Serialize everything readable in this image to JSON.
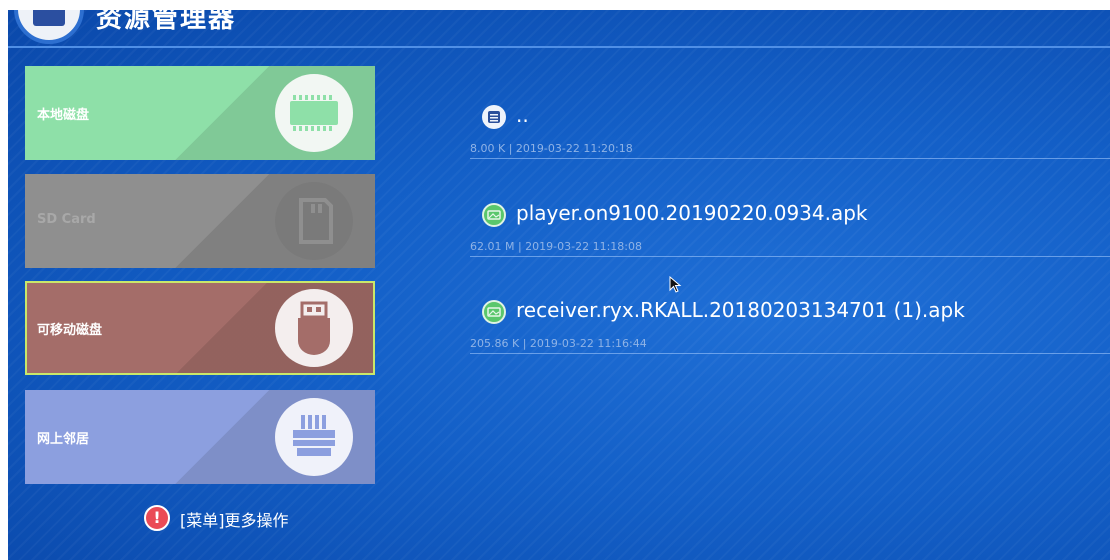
{
  "header": {
    "title": "资源管理器"
  },
  "sidebar": {
    "items": [
      {
        "label": "本地磁盘",
        "icon": "memory-chip-icon"
      },
      {
        "label": "SD Card",
        "icon": "sd-card-icon"
      },
      {
        "label": "可移动磁盘",
        "icon": "usb-drive-icon"
      },
      {
        "label": "网上邻居",
        "icon": "network-adapter-icon"
      }
    ],
    "selected": "可移动磁盘"
  },
  "hint": {
    "text": "[菜单]更多操作",
    "icon": "exclamation-icon"
  },
  "files": [
    {
      "name": "..",
      "meta": "8.00 K | 2019-03-22 11:20:18",
      "icon": "folder-icon"
    },
    {
      "name": "player.on9100.20190220.0934.apk",
      "meta": "62.01 M | 2019-03-22 11:18:08",
      "icon": "apk-icon"
    },
    {
      "name": "receiver.ryx.RKALL.20180203134701 (1).apk",
      "meta": "205.86 K | 2019-03-22 11:16:44",
      "icon": "apk-icon"
    }
  ],
  "colors": {
    "background": "#135fc7",
    "tile_local": "#8ee0a8",
    "tile_sd": "#8f8f8f",
    "tile_usb": "#a46d69",
    "tile_net": "#8c9fdf",
    "selection_border": "#c9e86a",
    "meta_text": "#8fb3e6"
  }
}
